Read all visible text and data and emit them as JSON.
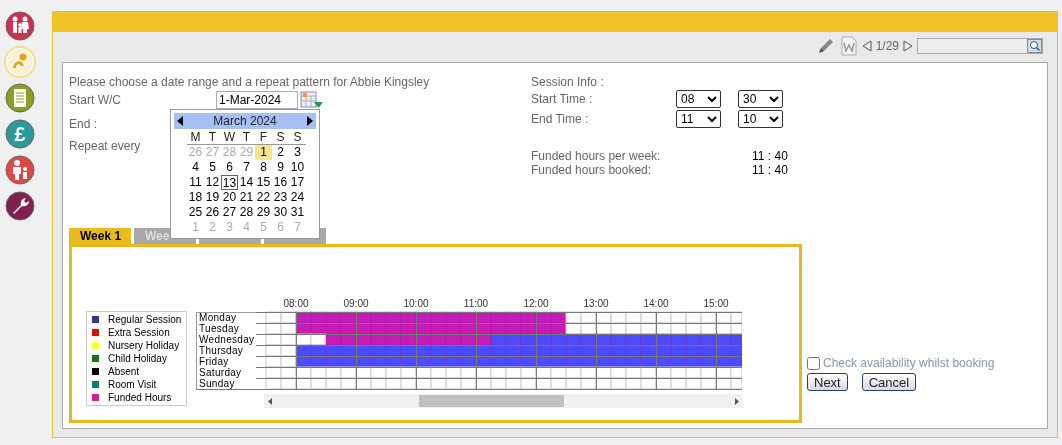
{
  "sidebar": {
    "items": [
      {
        "kind": "family",
        "selected": false
      },
      {
        "kind": "baby",
        "selected": true
      },
      {
        "kind": "document",
        "selected": false
      },
      {
        "kind": "money",
        "symbol": "£",
        "selected": false
      },
      {
        "kind": "parent",
        "selected": false
      },
      {
        "kind": "wrench",
        "selected": false
      }
    ]
  },
  "toolbar": {
    "page": "1/29"
  },
  "form": {
    "intro": "Please choose a date range and a repeat pattern for Abbie Kingsley",
    "start_label": "Start W/C",
    "start_value": "1-Mar-2024",
    "end_label": "End :",
    "repeat_label": "Repeat every"
  },
  "calendar": {
    "month": "March 2024",
    "weekdays": [
      "M",
      "T",
      "W",
      "T",
      "F",
      "S",
      "S"
    ],
    "weeks": [
      [
        {
          "d": "26",
          "other": true,
          "selected": false,
          "today": false
        },
        {
          "d": "27",
          "other": true,
          "selected": false,
          "today": false
        },
        {
          "d": "28",
          "other": true,
          "selected": false,
          "today": false
        },
        {
          "d": "29",
          "other": true,
          "selected": false,
          "today": false
        },
        {
          "d": "1",
          "other": false,
          "selected": true,
          "today": false
        },
        {
          "d": "2",
          "other": false,
          "selected": false,
          "today": false
        },
        {
          "d": "3",
          "other": false,
          "selected": false,
          "today": false
        }
      ],
      [
        {
          "d": "4",
          "other": false,
          "selected": false,
          "today": false
        },
        {
          "d": "5",
          "other": false,
          "selected": false,
          "today": false
        },
        {
          "d": "6",
          "other": false,
          "selected": false,
          "today": false
        },
        {
          "d": "7",
          "other": false,
          "selected": false,
          "today": false
        },
        {
          "d": "8",
          "other": false,
          "selected": false,
          "today": false
        },
        {
          "d": "9",
          "other": false,
          "selected": false,
          "today": false
        },
        {
          "d": "10",
          "other": false,
          "selected": false,
          "today": false
        }
      ],
      [
        {
          "d": "11",
          "other": false,
          "selected": false,
          "today": false
        },
        {
          "d": "12",
          "other": false,
          "selected": false,
          "today": false
        },
        {
          "d": "13",
          "other": false,
          "selected": false,
          "today": true
        },
        {
          "d": "14",
          "other": false,
          "selected": false,
          "today": false
        },
        {
          "d": "15",
          "other": false,
          "selected": false,
          "today": false
        },
        {
          "d": "16",
          "other": false,
          "selected": false,
          "today": false
        },
        {
          "d": "17",
          "other": false,
          "selected": false,
          "today": false
        }
      ],
      [
        {
          "d": "18",
          "other": false,
          "selected": false,
          "today": false
        },
        {
          "d": "19",
          "other": false,
          "selected": false,
          "today": false
        },
        {
          "d": "20",
          "other": false,
          "selected": false,
          "today": false
        },
        {
          "d": "21",
          "other": false,
          "selected": false,
          "today": false
        },
        {
          "d": "22",
          "other": false,
          "selected": false,
          "today": false
        },
        {
          "d": "23",
          "other": false,
          "selected": false,
          "today": false
        },
        {
          "d": "24",
          "other": false,
          "selected": false,
          "today": false
        }
      ],
      [
        {
          "d": "25",
          "other": false,
          "selected": false,
          "today": false
        },
        {
          "d": "26",
          "other": false,
          "selected": false,
          "today": false
        },
        {
          "d": "27",
          "other": false,
          "selected": false,
          "today": false
        },
        {
          "d": "28",
          "other": false,
          "selected": false,
          "today": false
        },
        {
          "d": "29",
          "other": false,
          "selected": false,
          "today": false
        },
        {
          "d": "30",
          "other": false,
          "selected": false,
          "today": false
        },
        {
          "d": "31",
          "other": false,
          "selected": false,
          "today": false
        }
      ],
      [
        {
          "d": "1",
          "other": true,
          "selected": false,
          "today": false
        },
        {
          "d": "2",
          "other": true,
          "selected": false,
          "today": false
        },
        {
          "d": "3",
          "other": true,
          "selected": false,
          "today": false
        },
        {
          "d": "4",
          "other": true,
          "selected": false,
          "today": false
        },
        {
          "d": "5",
          "other": true,
          "selected": false,
          "today": false
        },
        {
          "d": "6",
          "other": true,
          "selected": false,
          "today": false
        },
        {
          "d": "7",
          "other": true,
          "selected": false,
          "today": false
        }
      ]
    ]
  },
  "session": {
    "title": "Session Info :",
    "start_label": "Start Time :",
    "start_hour": "08",
    "start_minute": "30",
    "end_label": "End Time :",
    "end_hour": "11",
    "end_minute": "10",
    "funded_per_week_label": "Funded hours per week:",
    "funded_per_week": "11 : 40",
    "funded_booked_label": "Funded hours booked:",
    "funded_booked": "11 : 40"
  },
  "tabs": [
    {
      "label": "Week 1",
      "selected": true
    },
    {
      "label": "Wee",
      "selected": false
    },
    {
      "selected": false
    },
    {
      "selected": false
    }
  ],
  "legend": [
    {
      "label": "Regular Session",
      "color": "#333399"
    },
    {
      "label": "Extra Session",
      "color": "#cc1111"
    },
    {
      "label": "Nursery Holiday",
      "color": "#ffff33"
    },
    {
      "label": "Child Holiday",
      "color": "#117711"
    },
    {
      "label": "Absent",
      "color": "#000000"
    },
    {
      "label": "Room Visit",
      "color": "#117777"
    },
    {
      "label": "Funded Hours",
      "color": "#cc2299"
    }
  ],
  "schedule": {
    "hours": [
      "08:00",
      "09:00",
      "10:00",
      "11:00",
      "12:00",
      "13:00",
      "14:00",
      "15:00"
    ],
    "rows": [
      {
        "day": "Monday",
        "slots": [
          {
            "kind": "free"
          },
          {
            "kind": "free"
          },
          {
            "kind": "funded"
          },
          {
            "kind": "funded"
          },
          {
            "kind": "funded"
          },
          {
            "kind": "funded"
          },
          {
            "kind": "funded"
          },
          {
            "kind": "funded"
          },
          {
            "kind": "funded"
          },
          {
            "kind": "funded"
          },
          {
            "kind": "funded"
          },
          {
            "kind": "funded"
          },
          {
            "kind": "funded"
          },
          {
            "kind": "funded"
          },
          {
            "kind": "funded"
          },
          {
            "kind": "funded"
          },
          {
            "kind": "funded"
          },
          {
            "kind": "funded"
          },
          {
            "kind": "funded"
          },
          {
            "kind": "funded"
          },
          {
            "kind": "free"
          },
          {
            "kind": "free"
          },
          {
            "kind": "free"
          },
          {
            "kind": "free"
          },
          {
            "kind": "free"
          },
          {
            "kind": "free"
          },
          {
            "kind": "free"
          },
          {
            "kind": "free"
          },
          {
            "kind": "free"
          },
          {
            "kind": "free"
          },
          {
            "kind": "free"
          },
          {
            "kind": "free"
          }
        ]
      },
      {
        "day": "Tuesday",
        "slots": [
          {
            "kind": "free"
          },
          {
            "kind": "free"
          },
          {
            "kind": "funded"
          },
          {
            "kind": "funded"
          },
          {
            "kind": "funded"
          },
          {
            "kind": "funded"
          },
          {
            "kind": "funded"
          },
          {
            "kind": "funded"
          },
          {
            "kind": "funded"
          },
          {
            "kind": "funded"
          },
          {
            "kind": "funded"
          },
          {
            "kind": "funded"
          },
          {
            "kind": "funded"
          },
          {
            "kind": "funded"
          },
          {
            "kind": "funded"
          },
          {
            "kind": "funded"
          },
          {
            "kind": "funded"
          },
          {
            "kind": "funded"
          },
          {
            "kind": "funded"
          },
          {
            "kind": "funded"
          },
          {
            "kind": "free"
          },
          {
            "kind": "free"
          },
          {
            "kind": "free"
          },
          {
            "kind": "free"
          },
          {
            "kind": "free"
          },
          {
            "kind": "free"
          },
          {
            "kind": "free"
          },
          {
            "kind": "free"
          },
          {
            "kind": "free"
          },
          {
            "kind": "free"
          },
          {
            "kind": "free"
          },
          {
            "kind": "free"
          }
        ]
      },
      {
        "day": "Wednesday",
        "slots": [
          {
            "kind": "free"
          },
          {
            "kind": "free"
          },
          {
            "kind": "free"
          },
          {
            "kind": "free"
          },
          {
            "kind": "funded"
          },
          {
            "kind": "funded"
          },
          {
            "kind": "funded"
          },
          {
            "kind": "funded"
          },
          {
            "kind": "funded"
          },
          {
            "kind": "funded"
          },
          {
            "kind": "funded"
          },
          {
            "kind": "funded"
          },
          {
            "kind": "funded"
          },
          {
            "kind": "funded"
          },
          {
            "kind": "funded"
          },
          {
            "kind": "regular"
          },
          {
            "kind": "regular"
          },
          {
            "kind": "regular"
          },
          {
            "kind": "regular"
          },
          {
            "kind": "regular"
          },
          {
            "kind": "regular"
          },
          {
            "kind": "regular"
          },
          {
            "kind": "regular"
          },
          {
            "kind": "regular"
          },
          {
            "kind": "regular"
          },
          {
            "kind": "regular"
          },
          {
            "kind": "regular"
          },
          {
            "kind": "regular"
          },
          {
            "kind": "regular"
          },
          {
            "kind": "regular"
          },
          {
            "kind": "regular"
          },
          {
            "kind": "regular"
          }
        ]
      },
      {
        "day": "Thursday",
        "slots": [
          {
            "kind": "free"
          },
          {
            "kind": "free"
          },
          {
            "kind": "regular"
          },
          {
            "kind": "regular"
          },
          {
            "kind": "regular"
          },
          {
            "kind": "regular"
          },
          {
            "kind": "regular"
          },
          {
            "kind": "regular"
          },
          {
            "kind": "regular"
          },
          {
            "kind": "regular"
          },
          {
            "kind": "regular"
          },
          {
            "kind": "regular"
          },
          {
            "kind": "regular"
          },
          {
            "kind": "regular"
          },
          {
            "kind": "regular"
          },
          {
            "kind": "regular"
          },
          {
            "kind": "regular"
          },
          {
            "kind": "regular"
          },
          {
            "kind": "regular"
          },
          {
            "kind": "regular"
          },
          {
            "kind": "regular"
          },
          {
            "kind": "regular"
          },
          {
            "kind": "regular"
          },
          {
            "kind": "regular"
          },
          {
            "kind": "regular"
          },
          {
            "kind": "regular"
          },
          {
            "kind": "regular"
          },
          {
            "kind": "regular"
          },
          {
            "kind": "regular"
          },
          {
            "kind": "regular"
          },
          {
            "kind": "regular"
          },
          {
            "kind": "regular"
          }
        ]
      },
      {
        "day": "Friday",
        "slots": [
          {
            "kind": "free"
          },
          {
            "kind": "free"
          },
          {
            "kind": "regular"
          },
          {
            "kind": "regular"
          },
          {
            "kind": "regular"
          },
          {
            "kind": "regular"
          },
          {
            "kind": "regular"
          },
          {
            "kind": "regular"
          },
          {
            "kind": "regular"
          },
          {
            "kind": "regular"
          },
          {
            "kind": "regular"
          },
          {
            "kind": "regular"
          },
          {
            "kind": "regular"
          },
          {
            "kind": "regular"
          },
          {
            "kind": "regular"
          },
          {
            "kind": "regular"
          },
          {
            "kind": "regular"
          },
          {
            "kind": "regular"
          },
          {
            "kind": "regular"
          },
          {
            "kind": "regular"
          },
          {
            "kind": "regular"
          },
          {
            "kind": "regular"
          },
          {
            "kind": "regular"
          },
          {
            "kind": "regular"
          },
          {
            "kind": "regular"
          },
          {
            "kind": "regular"
          },
          {
            "kind": "regular"
          },
          {
            "kind": "regular"
          },
          {
            "kind": "regular"
          },
          {
            "kind": "regular"
          },
          {
            "kind": "regular"
          },
          {
            "kind": "regular"
          }
        ]
      },
      {
        "day": "Saturday",
        "slots": [
          {
            "kind": "free"
          },
          {
            "kind": "free"
          },
          {
            "kind": "free"
          },
          {
            "kind": "free"
          },
          {
            "kind": "free"
          },
          {
            "kind": "free"
          },
          {
            "kind": "free"
          },
          {
            "kind": "free"
          },
          {
            "kind": "free"
          },
          {
            "kind": "free"
          },
          {
            "kind": "free"
          },
          {
            "kind": "free"
          },
          {
            "kind": "free"
          },
          {
            "kind": "free"
          },
          {
            "kind": "free"
          },
          {
            "kind": "free"
          },
          {
            "kind": "free"
          },
          {
            "kind": "free"
          },
          {
            "kind": "free"
          },
          {
            "kind": "free"
          },
          {
            "kind": "free"
          },
          {
            "kind": "free"
          },
          {
            "kind": "free"
          },
          {
            "kind": "free"
          },
          {
            "kind": "free"
          },
          {
            "kind": "free"
          },
          {
            "kind": "free"
          },
          {
            "kind": "free"
          },
          {
            "kind": "free"
          },
          {
            "kind": "free"
          },
          {
            "kind": "free"
          },
          {
            "kind": "free"
          }
        ]
      },
      {
        "day": "Sunday",
        "slots": [
          {
            "kind": "free"
          },
          {
            "kind": "free"
          },
          {
            "kind": "free"
          },
          {
            "kind": "free"
          },
          {
            "kind": "free"
          },
          {
            "kind": "free"
          },
          {
            "kind": "free"
          },
          {
            "kind": "free"
          },
          {
            "kind": "free"
          },
          {
            "kind": "free"
          },
          {
            "kind": "free"
          },
          {
            "kind": "free"
          },
          {
            "kind": "free"
          },
          {
            "kind": "free"
          },
          {
            "kind": "free"
          },
          {
            "kind": "free"
          },
          {
            "kind": "free"
          },
          {
            "kind": "free"
          },
          {
            "kind": "free"
          },
          {
            "kind": "free"
          },
          {
            "kind": "free"
          },
          {
            "kind": "free"
          },
          {
            "kind": "free"
          },
          {
            "kind": "free"
          },
          {
            "kind": "free"
          },
          {
            "kind": "free"
          },
          {
            "kind": "free"
          },
          {
            "kind": "free"
          },
          {
            "kind": "free"
          },
          {
            "kind": "free"
          },
          {
            "kind": "free"
          },
          {
            "kind": "free"
          }
        ]
      }
    ]
  },
  "check_availability": {
    "label": "Check availability whilst booking",
    "checked": false
  },
  "buttons": [
    "Next",
    "Cancel"
  ]
}
